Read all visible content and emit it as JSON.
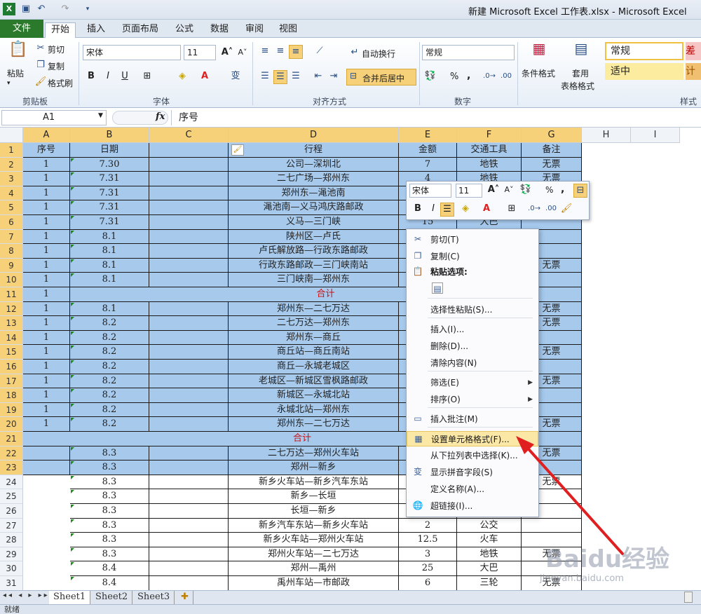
{
  "title": "新建 Microsoft Excel 工作表.xlsx - Microsoft Excel",
  "tabs": [
    "文件",
    "开始",
    "插入",
    "页面布局",
    "公式",
    "数据",
    "审阅",
    "视图"
  ],
  "ribbon": {
    "paste": "粘贴",
    "cut": "剪切",
    "copy": "复制",
    "format_painter": "格式刷",
    "clipboard": "剪贴板",
    "font_name": "宋体",
    "font_size": "11",
    "font_group": "字体",
    "wrap_text": "自动换行",
    "merge_center": "合并后居中",
    "align_group": "对齐方式",
    "number_format": "常规",
    "number_group": "数字",
    "cond_format": "条件格式",
    "table_format_1": "套用",
    "table_format_2": "表格格式",
    "style_normal": "常规",
    "style_bad": "差",
    "style_neutral": "适中",
    "style_calc": "计",
    "styles_group": "样式",
    "percent": "%",
    "comma": ","
  },
  "formula": {
    "name_box": "A1",
    "fx": "fx",
    "content": "序号"
  },
  "columns": [
    "A",
    "B",
    "C",
    "D",
    "E",
    "F",
    "G",
    "H",
    "I"
  ],
  "rows": [
    {
      "n": "1",
      "a": "序号",
      "b": "日期",
      "c": "",
      "d": "行程",
      "e": "金额",
      "f": "交通工具",
      "g": "备注"
    },
    {
      "n": "2",
      "a": "1",
      "b": "7.30",
      "c": "",
      "d": "公司—深圳北",
      "e": "7",
      "f": "地铁",
      "g": "无票"
    },
    {
      "n": "3",
      "a": "1",
      "b": "7.31",
      "c": "",
      "d": "二七广场—郑州东",
      "e": "4",
      "f": "地铁",
      "g": "无票"
    },
    {
      "n": "4",
      "a": "1",
      "b": "7.31",
      "c": "",
      "d": "郑州东—渑池南",
      "e": "",
      "f": "",
      "g": ""
    },
    {
      "n": "5",
      "a": "1",
      "b": "7.31",
      "c": "",
      "d": "渑池南—义马鸿庆路邮政",
      "e": "",
      "f": "",
      "g": ""
    },
    {
      "n": "6",
      "a": "1",
      "b": "7.31",
      "c": "",
      "d": "义马—三门峡",
      "e": "15",
      "f": "大巴",
      "g": ""
    },
    {
      "n": "7",
      "a": "1",
      "b": "8.1",
      "c": "",
      "d": "陕州区—卢氏",
      "e": "",
      "f": "",
      "g": ""
    },
    {
      "n": "8",
      "a": "1",
      "b": "8.1",
      "c": "",
      "d": "卢氏解放路—行政东路邮政",
      "e": "",
      "f": "",
      "g": ""
    },
    {
      "n": "9",
      "a": "1",
      "b": "8.1",
      "c": "",
      "d": "行政东路邮政—三门峡南站",
      "e": "",
      "f": "",
      "g": "无票"
    },
    {
      "n": "10",
      "a": "1",
      "b": "8.1",
      "c": "",
      "d": "三门峡南—郑州东",
      "e": "",
      "f": "",
      "g": ""
    },
    {
      "n": "11",
      "a": "1",
      "b": "",
      "c": "",
      "d": "合计",
      "e": "",
      "f": "",
      "g": "",
      "total": true
    },
    {
      "n": "12",
      "a": "1",
      "b": "8.1",
      "c": "",
      "d": "郑州东—二七万达",
      "e": "",
      "f": "",
      "g": "无票"
    },
    {
      "n": "13",
      "a": "1",
      "b": "8.2",
      "c": "",
      "d": "二七万达—郑州东",
      "e": "",
      "f": "",
      "g": "无票"
    },
    {
      "n": "14",
      "a": "1",
      "b": "8.2",
      "c": "",
      "d": "郑州东—商丘",
      "e": "",
      "f": "",
      "g": ""
    },
    {
      "n": "15",
      "a": "1",
      "b": "8.2",
      "c": "",
      "d": "商丘站—商丘南站",
      "e": "",
      "f": "",
      "g": "无票"
    },
    {
      "n": "16",
      "a": "1",
      "b": "8.2",
      "c": "",
      "d": "商丘—永城老城区",
      "e": "",
      "f": "",
      "g": ""
    },
    {
      "n": "17",
      "a": "1",
      "b": "8.2",
      "c": "",
      "d": "老城区—新城区雪枫路邮政",
      "e": "",
      "f": "",
      "g": "无票"
    },
    {
      "n": "18",
      "a": "1",
      "b": "8.2",
      "c": "",
      "d": "新城区—永城北站",
      "e": "",
      "f": "",
      "g": ""
    },
    {
      "n": "19",
      "a": "1",
      "b": "8.2",
      "c": "",
      "d": "永城北站—郑州东",
      "e": "",
      "f": "",
      "g": ""
    },
    {
      "n": "20",
      "a": "1",
      "b": "8.2",
      "c": "",
      "d": "郑州东—二七万达",
      "e": "",
      "f": "",
      "g": "无票"
    },
    {
      "n": "21",
      "a": "",
      "b": "",
      "c": "",
      "d": "合计",
      "e": "",
      "f": "",
      "g": "",
      "total": true
    },
    {
      "n": "22",
      "a": "",
      "b": "8.3",
      "c": "",
      "d": "二七万达—郑州火车站",
      "e": "",
      "f": "",
      "g": "无票"
    },
    {
      "n": "23",
      "a": "",
      "b": "8.3",
      "c": "",
      "d": "郑州—新乡",
      "e": "",
      "f": "",
      "g": ""
    },
    {
      "n": "24",
      "a": "",
      "b": "8.3",
      "c": "",
      "d": "新乡火车站—新乡汽车东站",
      "e": "",
      "f": "",
      "g": "无票"
    },
    {
      "n": "25",
      "a": "",
      "b": "8.3",
      "c": "",
      "d": "新乡—长垣",
      "e": "",
      "f": "",
      "g": ""
    },
    {
      "n": "26",
      "a": "",
      "b": "8.3",
      "c": "",
      "d": "长垣—新乡",
      "e": "",
      "f": "",
      "g": ""
    },
    {
      "n": "27",
      "a": "",
      "b": "8.3",
      "c": "",
      "d": "新乡汽车东站—新乡火车站",
      "e": "2",
      "f": "公交",
      "g": ""
    },
    {
      "n": "28",
      "a": "",
      "b": "8.3",
      "c": "",
      "d": "新乡火车站—郑州火车站",
      "e": "12.5",
      "f": "火车",
      "g": ""
    },
    {
      "n": "29",
      "a": "",
      "b": "8.3",
      "c": "",
      "d": "郑州火车站—二七万达",
      "e": "3",
      "f": "地铁",
      "g": "无票"
    },
    {
      "n": "30",
      "a": "",
      "b": "8.4",
      "c": "",
      "d": "郑州—禹州",
      "e": "25",
      "f": "大巴",
      "g": ""
    },
    {
      "n": "31",
      "a": "",
      "b": "8.4",
      "c": "",
      "d": "禹州车站—市邮政",
      "e": "6",
      "f": "三轮",
      "g": "无票"
    }
  ],
  "minibar": {
    "font": "宋体",
    "size": "11",
    "percent": "%",
    "comma": ","
  },
  "context_menu": [
    {
      "label": "剪切(T)",
      "icon": "scissors-icon",
      "glyph": "✂"
    },
    {
      "label": "复制(C)",
      "icon": "copy-icon",
      "glyph": "❐"
    },
    {
      "label": "粘贴选项:",
      "icon": "paste-icon",
      "glyph": "📋",
      "bold": true
    },
    {
      "label": "",
      "icon": "paste-option-icon",
      "glyph": "▤"
    },
    {
      "label": "选择性粘贴(S)...",
      "icon": "",
      "glyph": ""
    },
    {
      "label": "插入(I)...",
      "icon": "",
      "glyph": ""
    },
    {
      "label": "删除(D)...",
      "icon": "",
      "glyph": ""
    },
    {
      "label": "清除内容(N)",
      "icon": "",
      "glyph": ""
    },
    {
      "label": "筛选(E)",
      "icon": "",
      "glyph": "",
      "sub": true
    },
    {
      "label": "排序(O)",
      "icon": "",
      "glyph": "",
      "sub": true
    },
    {
      "label": "插入批注(M)",
      "icon": "comment-icon",
      "glyph": "▭"
    },
    {
      "label": "设置单元格格式(F)...",
      "icon": "format-cells-icon",
      "glyph": "▦",
      "highlight": true
    },
    {
      "label": "从下拉列表中选择(K)...",
      "icon": "",
      "glyph": ""
    },
    {
      "label": "显示拼音字段(S)",
      "icon": "phonetic-icon",
      "glyph": "变"
    },
    {
      "label": "定义名称(A)...",
      "icon": "",
      "glyph": ""
    },
    {
      "label": "超链接(I)...",
      "icon": "hyperlink-icon",
      "glyph": "🌐"
    }
  ],
  "sheets": [
    "Sheet1",
    "Sheet2",
    "Sheet3"
  ],
  "status": "就绪",
  "watermark": "Baidu经验",
  "watermark_url": "jingyan.baidu.com",
  "colors": {
    "selection": "#a6c9ec",
    "header_selected": "#f7d17a",
    "file_tab": "#2b7a2b",
    "arrow": "#e02020",
    "total_text": "#d01010"
  }
}
